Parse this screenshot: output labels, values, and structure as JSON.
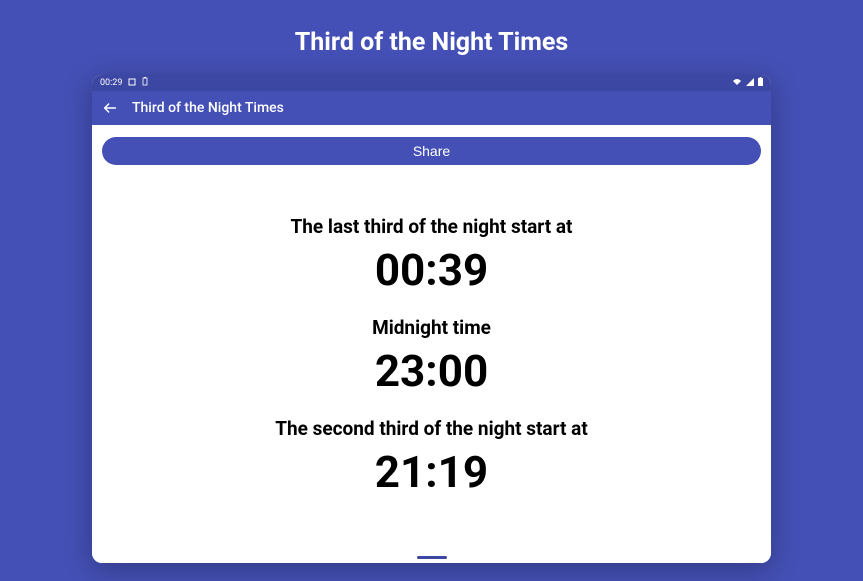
{
  "page_heading": "Third of the Night Times",
  "status_bar": {
    "clock": "00:29",
    "app_icon": "◻",
    "battery_icon": "🔋"
  },
  "app_bar": {
    "title": "Third of the Night Times"
  },
  "share_button_label": "Share",
  "times": [
    {
      "label": "The last third of the night start at",
      "value": "00:39"
    },
    {
      "label": "Midnight time",
      "value": "23:00"
    },
    {
      "label": "The second third of the night start at",
      "value": "21:19"
    }
  ]
}
